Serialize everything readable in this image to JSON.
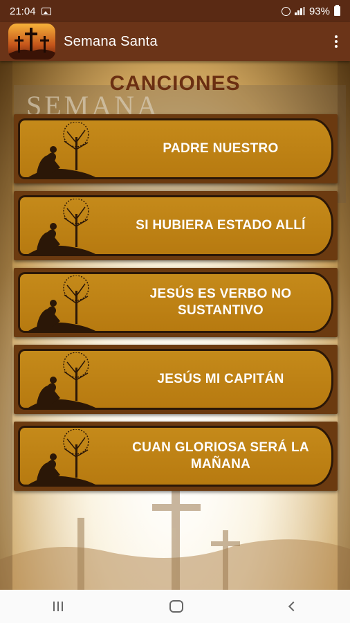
{
  "status_bar": {
    "time": "21:04",
    "battery": "93%",
    "icons": [
      "image-icon",
      "alarm-icon",
      "signal-icon",
      "battery-icon"
    ]
  },
  "app_bar": {
    "title": "Semana Santa",
    "logo_icon": "three-crosses-icon",
    "menu_icon": "more-vert-icon"
  },
  "main": {
    "section_title": "CANCIONES",
    "songs": [
      {
        "label": "PADRE NUESTRO"
      },
      {
        "label": "SI HUBIERA ESTADO ALLÍ"
      },
      {
        "label": "JESÚS ES VERBO NO SUSTANTIVO"
      },
      {
        "label": "JESÚS MI CAPITÁN"
      },
      {
        "label": "CUAN GLORIOSA SERÁ LA MAÑANA"
      }
    ]
  },
  "colors": {
    "app_bar": "#6b3418",
    "status_bar": "#5a2a14",
    "button_gold": "#c58a1a",
    "title_brown": "#6b2f12"
  },
  "nav_bar": {
    "icons": [
      "recents-icon",
      "home-icon",
      "back-icon"
    ]
  }
}
